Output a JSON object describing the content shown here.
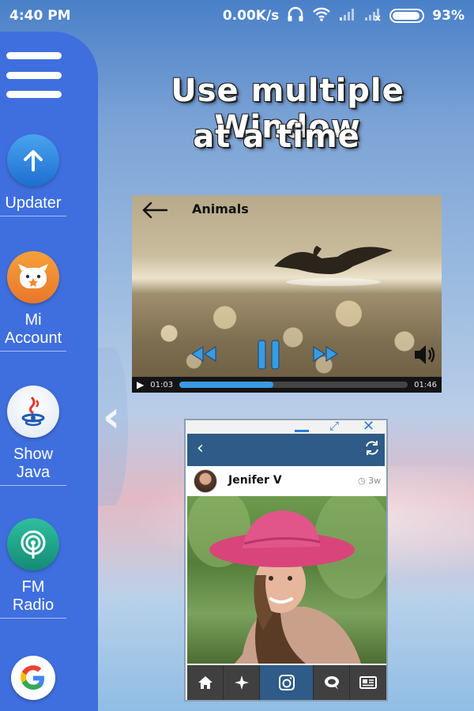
{
  "status_bar": {
    "time": "4:40 PM",
    "network_speed": "0.00K/s",
    "battery_percent": "93%",
    "battery_level": 0.93,
    "icons": [
      "headphones-icon",
      "wifi-icon",
      "signal-icon",
      "signal-x-icon",
      "battery-icon"
    ]
  },
  "sidebar": {
    "menu_icon": "hamburger-menu-icon",
    "apps": [
      {
        "label": "Updater",
        "icon": "updater-arrow-icon",
        "color": "#2f86e0"
      },
      {
        "label": "Mi\nAccount",
        "icon": "mi-account-icon",
        "color": "#f08a2b"
      },
      {
        "label": "Show\nJava",
        "icon": "java-icon",
        "color": "#e8ecf4"
      },
      {
        "label": "FM\nRadio",
        "icon": "radio-icon",
        "color": "#1fa58c"
      },
      {
        "label": "",
        "icon": "google-icon",
        "color": "#ffffff"
      }
    ],
    "accent": "#3f6fde"
  },
  "headline": {
    "line1": "Use multiple Window",
    "line2": "at a time"
  },
  "video_window": {
    "title": "Animals",
    "current_time": "01:03",
    "total_time": "01:46",
    "progress": 0.41,
    "progress_color": "#3a9be0"
  },
  "instagram_window": {
    "username": "Jenifer V",
    "time_ago": "3w",
    "nav_color": "#2e5b87",
    "tabs": [
      "home-icon",
      "explore-icon",
      "camera-icon",
      "comment-icon",
      "news-icon"
    ]
  }
}
